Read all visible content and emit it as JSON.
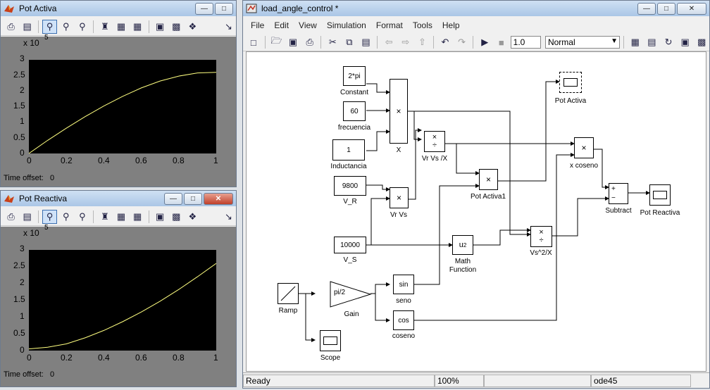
{
  "pot_activa": {
    "title": "Pot Activa",
    "time_offset_label": "Time offset:",
    "time_offset_value": "0",
    "exponent_base": "x 10",
    "exponent_power": "5",
    "y_ticks": [
      "3",
      "2.5",
      "2",
      "1.5",
      "1",
      "0.5",
      "0"
    ],
    "x_ticks": [
      "0",
      "0.2",
      "0.4",
      "0.6",
      "0.8",
      "1"
    ]
  },
  "pot_reactiva": {
    "title": "Pot Reactiva",
    "time_offset_label": "Time offset:",
    "time_offset_value": "0",
    "exponent_base": "x 10",
    "exponent_power": "5",
    "y_ticks": [
      "3",
      "2.5",
      "2",
      "1.5",
      "1",
      "0.5",
      "0"
    ],
    "x_ticks": [
      "0",
      "0.2",
      "0.4",
      "0.6",
      "0.8",
      "1"
    ]
  },
  "model": {
    "title": "load_angle_control *",
    "menus": [
      "File",
      "Edit",
      "View",
      "Simulation",
      "Format",
      "Tools",
      "Help"
    ],
    "stop_time": "1.0",
    "sim_mode": "Normal",
    "status": "Ready",
    "zoom": "100%",
    "solver": "ode45",
    "blocks": {
      "constant_value": "2*pi",
      "constant_label": "Constant",
      "freq_value": "60",
      "freq_label": "frecuencia",
      "ind_value": "1",
      "ind_label": "Inductancia",
      "product_x_symbol": "×",
      "product_x_label": "X",
      "vr_value": "9800",
      "vr_label": "V_R",
      "vrvs_symbol": "×",
      "vrvs_label": "Vr Vs",
      "vrvsx_label": "Vr Vs /X",
      "potactiva1_symbol": "×",
      "potactiva1_label": "Pot Activa1",
      "vs_value": "10000",
      "vs_label": "V_S",
      "math_value": "u2",
      "math_label_1": "Math",
      "math_label_2": "Function",
      "vs2x_label": "Vs^2/X",
      "xcoseno_symbol": "×",
      "xcoseno_label": "x coseno",
      "subtract_label": "Subtract",
      "scope_potactiva_label": "Pot Activa",
      "scope_potreactiva_label": "Pot Reactiva",
      "ramp_label": "Ramp",
      "gain_value": "pi/2",
      "gain_label": "Gain",
      "sin_value": "sin",
      "sin_label": "seno",
      "cos_value": "cos",
      "cos_label": "coseno",
      "scope_label": "Scope"
    }
  },
  "chart_data": [
    {
      "type": "line",
      "xlim": [
        0,
        1
      ],
      "ylim": [
        0,
        3
      ],
      "y_multiplier": "x 10^5",
      "x": [
        0,
        0.1,
        0.2,
        0.3,
        0.4,
        0.5,
        0.6,
        0.7,
        0.8,
        0.9,
        1.0
      ],
      "y": [
        0.0,
        0.42,
        0.81,
        1.18,
        1.52,
        1.83,
        2.1,
        2.32,
        2.48,
        2.58,
        2.6
      ],
      "grid": false,
      "color": "#ffff80"
    },
    {
      "type": "line",
      "xlim": [
        0,
        1
      ],
      "ylim": [
        0,
        3
      ],
      "y_multiplier": "x 10^5",
      "x": [
        0,
        0.1,
        0.2,
        0.3,
        0.4,
        0.5,
        0.6,
        0.7,
        0.8,
        0.9,
        1.0
      ],
      "y": [
        0.05,
        0.1,
        0.2,
        0.38,
        0.6,
        0.86,
        1.15,
        1.47,
        1.82,
        2.2,
        2.6
      ],
      "grid": false,
      "color": "#ffff80"
    }
  ]
}
